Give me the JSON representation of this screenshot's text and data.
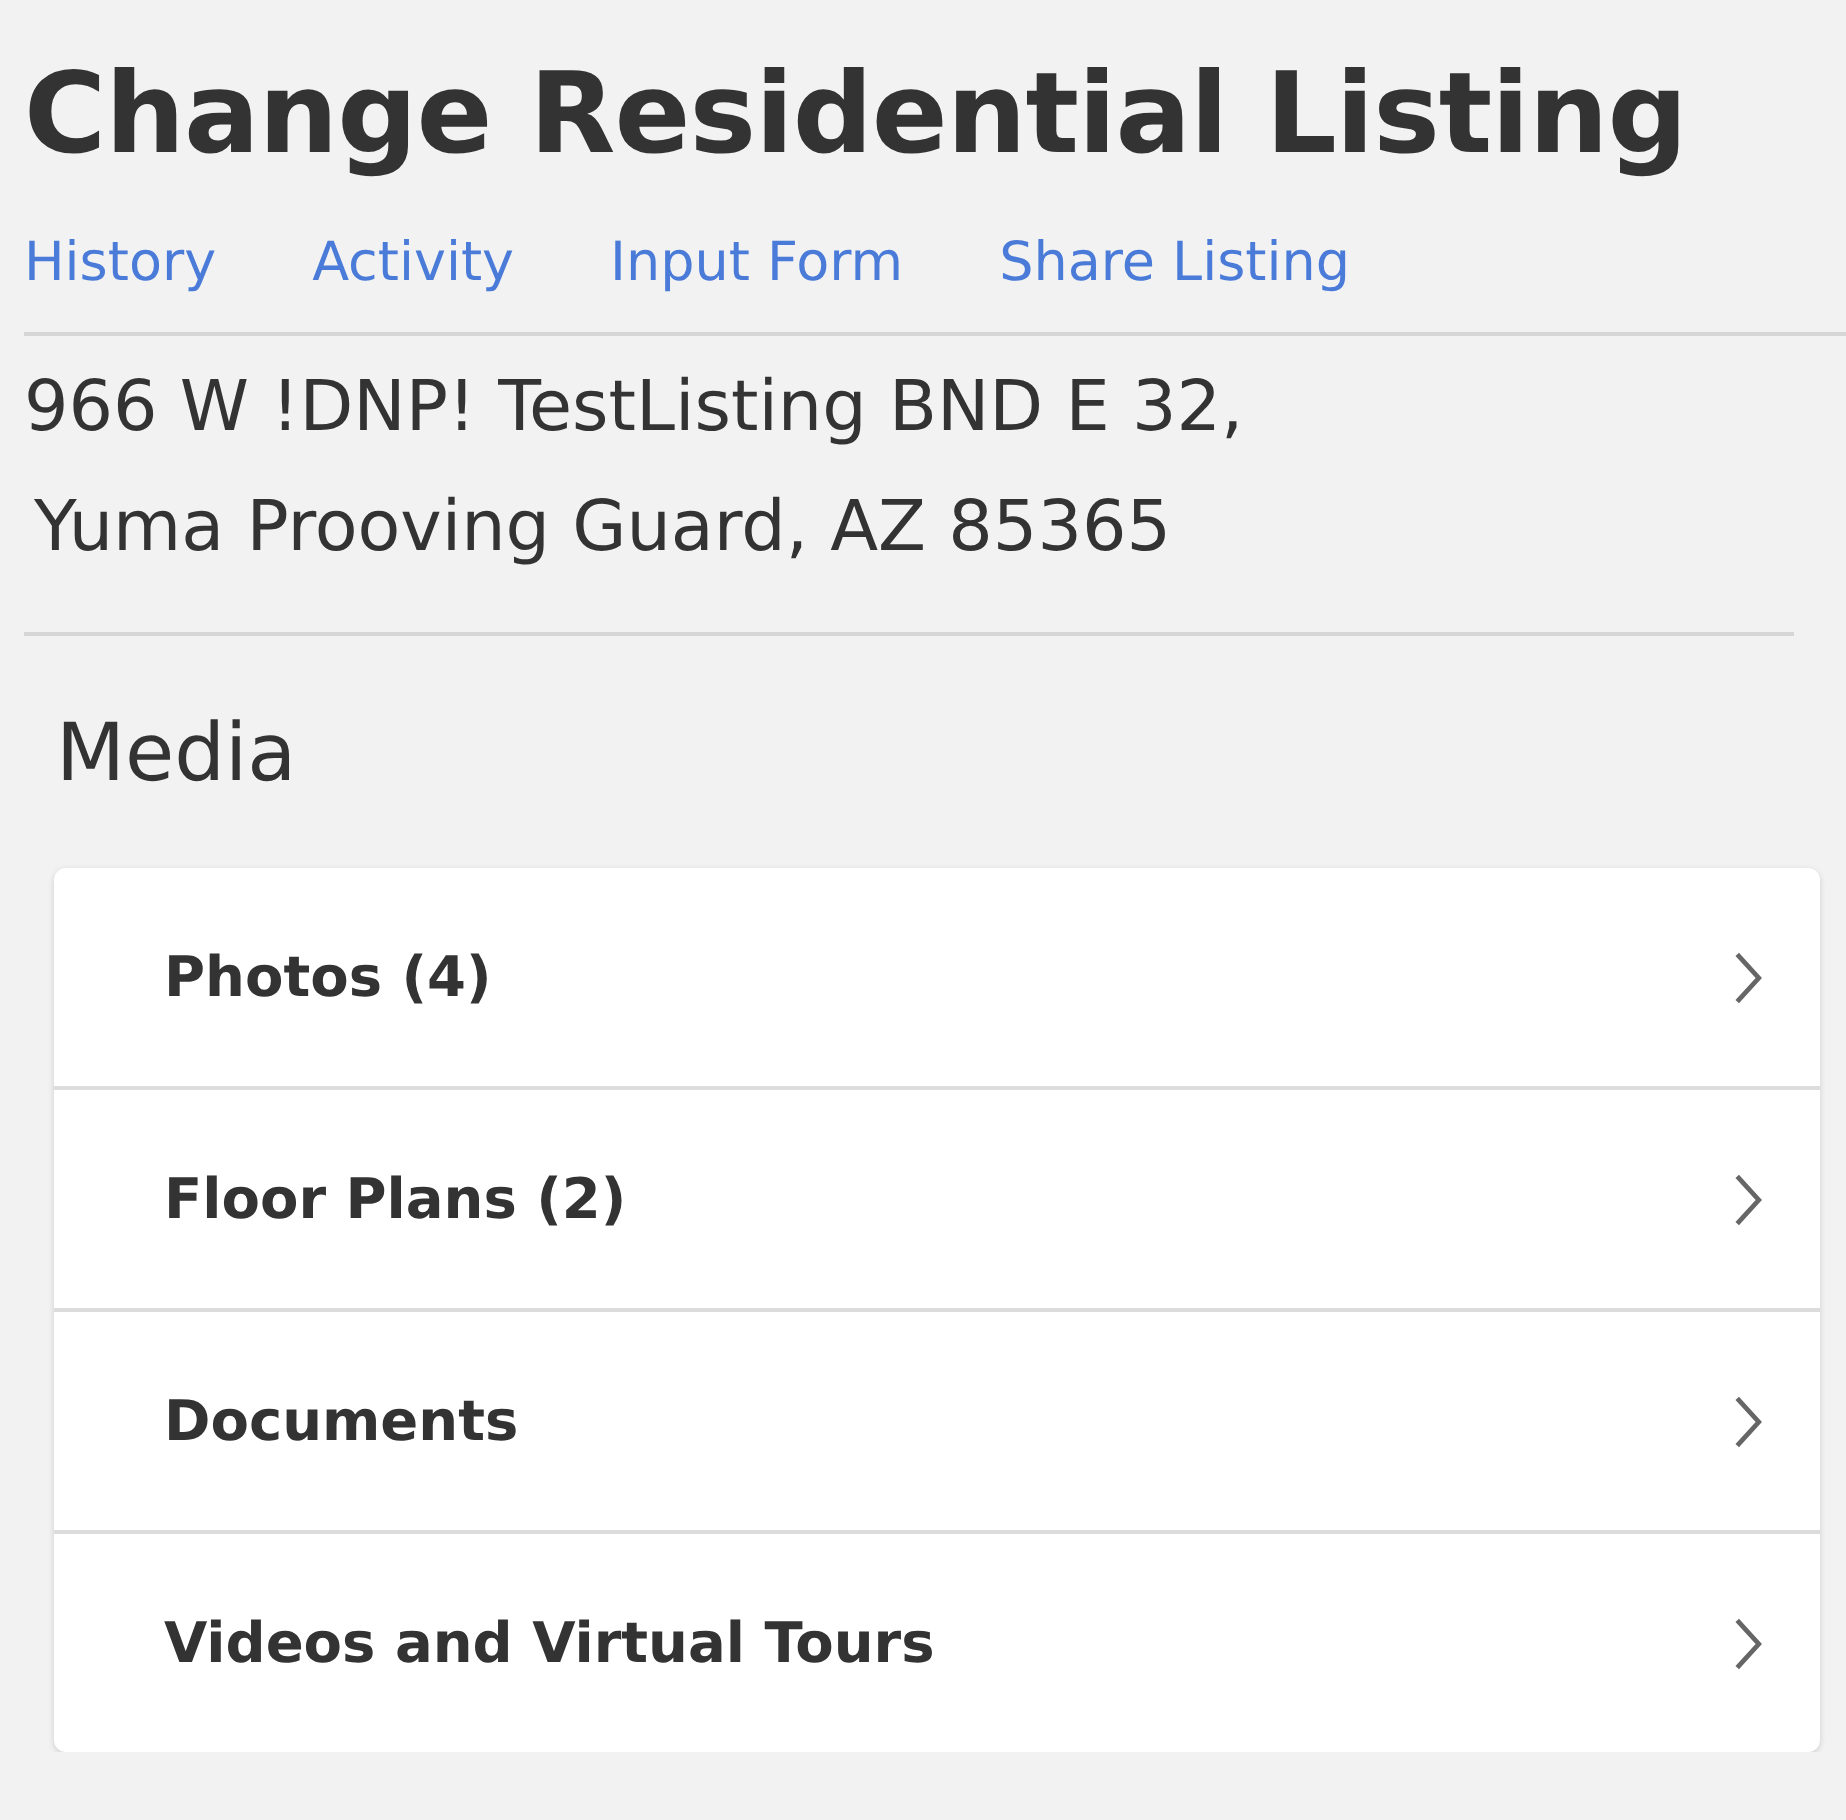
{
  "title": "Change Residential Listing",
  "links": [
    {
      "label": "History"
    },
    {
      "label": "Activity"
    },
    {
      "label": "Input Form"
    },
    {
      "label": "Share Listing"
    }
  ],
  "address": [
    "966 W !DNP! TestListing BND E 32,",
    "Yuma Prooving Guard, AZ 85365"
  ],
  "section": {
    "heading": "Media",
    "items": [
      {
        "label": "Photos (4)"
      },
      {
        "label": "Floor Plans (2)"
      },
      {
        "label": "Documents"
      },
      {
        "label": "Videos and Virtual Tours"
      }
    ]
  }
}
